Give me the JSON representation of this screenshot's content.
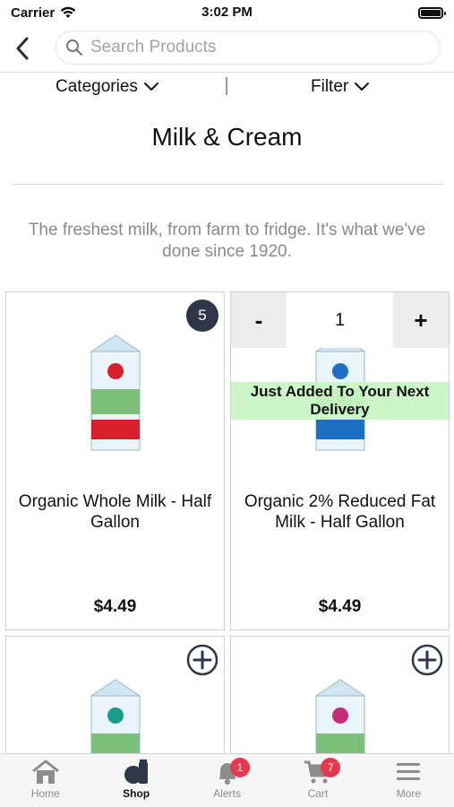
{
  "status_bar": {
    "carrier": "Carrier",
    "time": "3:02 PM"
  },
  "search": {
    "placeholder": "Search Products"
  },
  "filters": {
    "categories_label": "Categories",
    "filter_label": "Filter"
  },
  "page": {
    "title": "Milk & Cream",
    "tagline": "The freshest milk, from farm to fridge. It's what we've done since 1920."
  },
  "products": [
    {
      "name": "Organic Whole Milk - Half Gallon",
      "price": "$4.49",
      "cart_count": "5",
      "carton_color": "#d8202c"
    },
    {
      "name": "Organic 2% Reduced Fat Milk - Half Gallon",
      "price": "$4.49",
      "quantity": "1",
      "added_message": "Just Added To Your Next Delivery",
      "minus_label": "-",
      "plus_label": "+",
      "carton_color": "#1f6fc2"
    },
    {
      "name": "",
      "price": "",
      "carton_color": "#1a9c8a"
    },
    {
      "name": "",
      "price": "",
      "carton_color": "#c42d7a"
    }
  ],
  "tab_bar": {
    "tabs": [
      {
        "label": "Home",
        "icon": "home-icon"
      },
      {
        "label": "Shop",
        "icon": "shop-icon",
        "active": true
      },
      {
        "label": "Alerts",
        "icon": "bell-icon",
        "badge": "1"
      },
      {
        "label": "Cart",
        "icon": "cart-icon",
        "badge": "7"
      },
      {
        "label": "More",
        "icon": "menu-icon"
      }
    ]
  },
  "colors": {
    "badge_dark": "#2e3648",
    "badge_red": "#e53950",
    "added_banner": "#c8f5c3"
  }
}
